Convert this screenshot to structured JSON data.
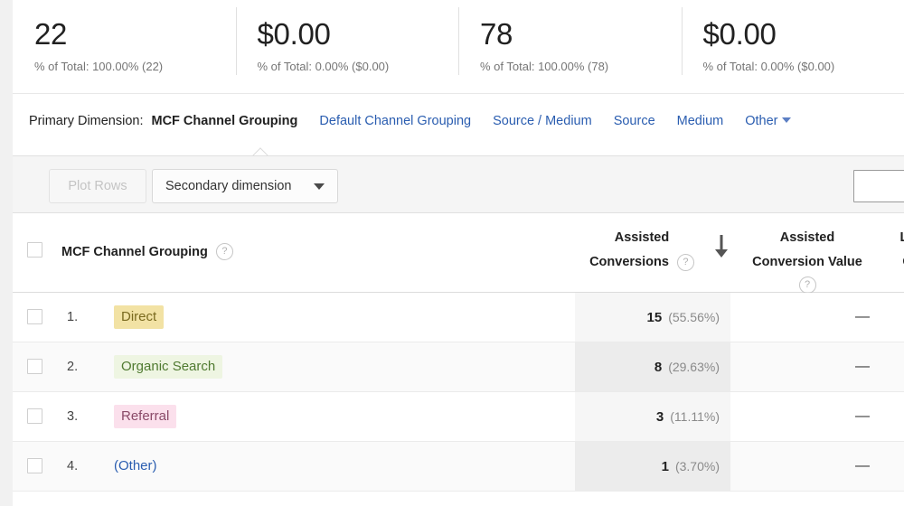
{
  "metrics": [
    {
      "value": "22",
      "subtext": "% of Total: 100.00% (22)"
    },
    {
      "value": "$0.00",
      "subtext": "% of Total: 0.00% ($0.00)"
    },
    {
      "value": "78",
      "subtext": "% of Total: 100.00% (78)"
    },
    {
      "value": "$0.00",
      "subtext": "% of Total: 0.00% ($0.00)"
    }
  ],
  "primary_dimension": {
    "label": "Primary Dimension:",
    "active": "MCF Channel Grouping",
    "links": [
      "Default Channel Grouping",
      "Source / Medium",
      "Source",
      "Medium"
    ],
    "other": "Other"
  },
  "toolbar": {
    "plot_rows": "Plot Rows",
    "secondary_dimension": "Secondary dimension",
    "search_value": "",
    "search_placeholder": ""
  },
  "table": {
    "dimension_header": "MCF Channel Grouping",
    "help_glyph": "?",
    "columns": {
      "assisted_conversions_l1": "Assisted",
      "assisted_conversions_l2": "Conversions",
      "assisted_conversion_value_l1": "Assisted",
      "assisted_conversion_value_l2": "Conversion Value",
      "last_click_l1": "Las",
      "last_click_l2": "Co"
    },
    "rows": [
      {
        "index": "1.",
        "label": "Direct",
        "pill_bg": "#f2e2a4",
        "pill_color": "#7a6a1f",
        "assisted_conversions": "15",
        "assisted_conversions_pct": "(55.56%)",
        "assisted_conversion_value": "—"
      },
      {
        "index": "2.",
        "label": "Organic Search",
        "pill_bg": "#eef5e2",
        "pill_color": "#4f7a30",
        "assisted_conversions": "8",
        "assisted_conversions_pct": "(29.63%)",
        "assisted_conversion_value": "—"
      },
      {
        "index": "3.",
        "label": "Referral",
        "pill_bg": "#fbe0ec",
        "pill_color": "#8a4a68",
        "assisted_conversions": "3",
        "assisted_conversions_pct": "(11.11%)",
        "assisted_conversion_value": "—"
      },
      {
        "index": "4.",
        "label": "(Other)",
        "pill_bg": "transparent",
        "pill_color": "#2a5db0",
        "assisted_conversions": "1",
        "assisted_conversions_pct": "(3.70%)",
        "assisted_conversion_value": "—"
      }
    ]
  },
  "colors": {
    "link": "#2a5db0",
    "page_bg": "#f1f1f1",
    "panel_bg": "#ffffff",
    "toolbar_bg": "#f5f5f5"
  }
}
